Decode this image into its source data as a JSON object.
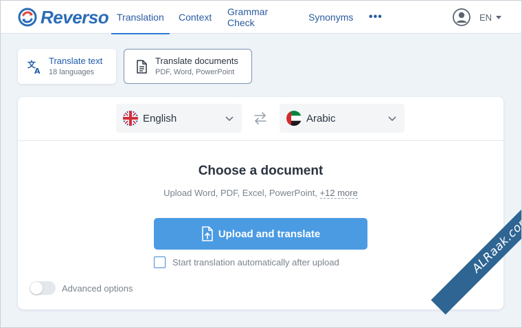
{
  "header": {
    "logo_text": "Reverso",
    "nav": [
      {
        "label": "Translation",
        "active": true
      },
      {
        "label": "Context",
        "active": false
      },
      {
        "label": "Grammar Check",
        "active": false
      },
      {
        "label": "Synonyms",
        "active": false
      }
    ],
    "more_label": "•••",
    "ui_language": "EN"
  },
  "modes": {
    "text": {
      "title": "Translate text",
      "subtitle": "18 languages"
    },
    "documents": {
      "title": "Translate documents",
      "subtitle": "PDF, Word, PowerPoint"
    }
  },
  "languages": {
    "source": {
      "name": "English",
      "flag": "uk-flag"
    },
    "target": {
      "name": "Arabic",
      "flag": "uae-flag"
    }
  },
  "upload": {
    "title": "Choose a document",
    "subtitle_prefix": "Upload Word, PDF, Excel, PowerPoint, ",
    "more_formats": "+12 more",
    "button_label": "Upload and translate",
    "auto_start_label": "Start translation automatically after upload",
    "auto_start_checked": false
  },
  "advanced": {
    "label": "Advanced options",
    "enabled": false
  },
  "watermark": {
    "text": "ALRaak.com"
  },
  "colors": {
    "brand": "#2b6cb8",
    "accent": "#4b9be3",
    "ribbon": "#2f6593"
  }
}
